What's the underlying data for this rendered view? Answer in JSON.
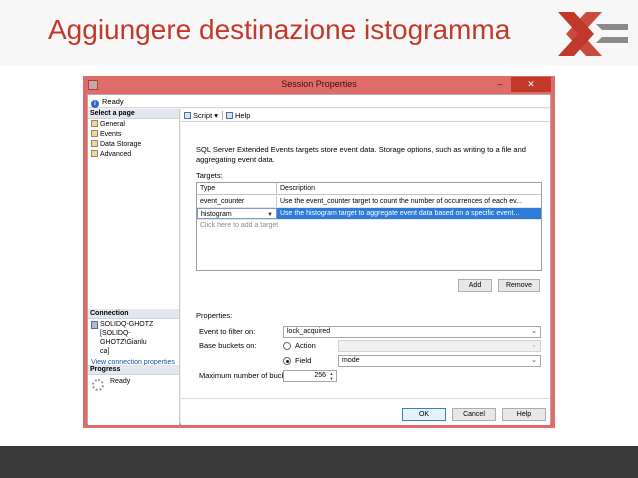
{
  "slide": {
    "title": "Aggiungere destinazione istogramma",
    "logo_icon": "x-logo-icon",
    "colors": {
      "title": "#c0392b",
      "window_border": "#e06c6a",
      "selection": "#2f7bd8",
      "footer": "#3a3a3a"
    }
  },
  "window": {
    "title": "Session Properties",
    "minimize_label": "–",
    "close_label": "✕"
  },
  "status": {
    "text": "Ready"
  },
  "left_pane": {
    "select_page_header": "Select a page",
    "pages": [
      {
        "label": "General"
      },
      {
        "label": "Events"
      },
      {
        "label": "Data Storage"
      },
      {
        "label": "Advanced"
      }
    ],
    "connection_header": "Connection",
    "connection_line1": "SOLIDQ-GHOTZ",
    "connection_line2": "[SOLIDQ-GHOTZ\\Gianlu",
    "connection_line3": "ca]",
    "view_connection_link": "View connection properties",
    "progress_header": "Progress",
    "progress_status": "Ready"
  },
  "toolbar": {
    "script_label": "Script",
    "script_dropdown": "▾",
    "help_label": "Help"
  },
  "main": {
    "description": "SQL Server Extended Events targets store event data. Storage options, such as writing to a file and aggregating event data.",
    "targets_label": "Targets:",
    "columns": {
      "type": "Type",
      "description": "Description"
    },
    "rows": [
      {
        "type": "event_counter",
        "description": "Use the event_counter target to count the number of occurrences of each ev..."
      },
      {
        "type": "histogram",
        "description": "Use the histogram target to aggregate event data based on a specific event..."
      }
    ],
    "add_target_placeholder": "Click here to add a target",
    "add_button": "Add",
    "remove_button": "Remove",
    "properties_label": "Properties:",
    "event_filter_label": "Event to filter on:",
    "event_filter_value": "lock_acquired",
    "base_buckets_label": "Base buckets on:",
    "action_option": "Action",
    "field_option": "Field",
    "field_value": "mode",
    "max_buckets_label": "Maximum number of buckets:",
    "max_buckets_value": "256",
    "ok_button": "OK",
    "cancel_button": "Cancel",
    "help_button": "Help"
  }
}
